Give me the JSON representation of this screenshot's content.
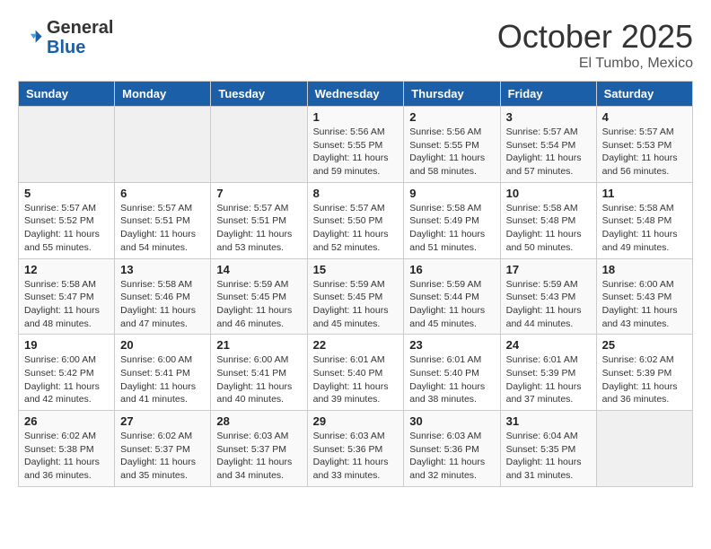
{
  "header": {
    "logo_general": "General",
    "logo_blue": "Blue",
    "month_title": "October 2025",
    "location": "El Tumbo, Mexico"
  },
  "days_of_week": [
    "Sunday",
    "Monday",
    "Tuesday",
    "Wednesday",
    "Thursday",
    "Friday",
    "Saturday"
  ],
  "weeks": [
    [
      {
        "day": "",
        "info": ""
      },
      {
        "day": "",
        "info": ""
      },
      {
        "day": "",
        "info": ""
      },
      {
        "day": "1",
        "info": "Sunrise: 5:56 AM\nSunset: 5:55 PM\nDaylight: 11 hours and 59 minutes."
      },
      {
        "day": "2",
        "info": "Sunrise: 5:56 AM\nSunset: 5:55 PM\nDaylight: 11 hours and 58 minutes."
      },
      {
        "day": "3",
        "info": "Sunrise: 5:57 AM\nSunset: 5:54 PM\nDaylight: 11 hours and 57 minutes."
      },
      {
        "day": "4",
        "info": "Sunrise: 5:57 AM\nSunset: 5:53 PM\nDaylight: 11 hours and 56 minutes."
      }
    ],
    [
      {
        "day": "5",
        "info": "Sunrise: 5:57 AM\nSunset: 5:52 PM\nDaylight: 11 hours and 55 minutes."
      },
      {
        "day": "6",
        "info": "Sunrise: 5:57 AM\nSunset: 5:51 PM\nDaylight: 11 hours and 54 minutes."
      },
      {
        "day": "7",
        "info": "Sunrise: 5:57 AM\nSunset: 5:51 PM\nDaylight: 11 hours and 53 minutes."
      },
      {
        "day": "8",
        "info": "Sunrise: 5:57 AM\nSunset: 5:50 PM\nDaylight: 11 hours and 52 minutes."
      },
      {
        "day": "9",
        "info": "Sunrise: 5:58 AM\nSunset: 5:49 PM\nDaylight: 11 hours and 51 minutes."
      },
      {
        "day": "10",
        "info": "Sunrise: 5:58 AM\nSunset: 5:48 PM\nDaylight: 11 hours and 50 minutes."
      },
      {
        "day": "11",
        "info": "Sunrise: 5:58 AM\nSunset: 5:48 PM\nDaylight: 11 hours and 49 minutes."
      }
    ],
    [
      {
        "day": "12",
        "info": "Sunrise: 5:58 AM\nSunset: 5:47 PM\nDaylight: 11 hours and 48 minutes."
      },
      {
        "day": "13",
        "info": "Sunrise: 5:58 AM\nSunset: 5:46 PM\nDaylight: 11 hours and 47 minutes."
      },
      {
        "day": "14",
        "info": "Sunrise: 5:59 AM\nSunset: 5:45 PM\nDaylight: 11 hours and 46 minutes."
      },
      {
        "day": "15",
        "info": "Sunrise: 5:59 AM\nSunset: 5:45 PM\nDaylight: 11 hours and 45 minutes."
      },
      {
        "day": "16",
        "info": "Sunrise: 5:59 AM\nSunset: 5:44 PM\nDaylight: 11 hours and 45 minutes."
      },
      {
        "day": "17",
        "info": "Sunrise: 5:59 AM\nSunset: 5:43 PM\nDaylight: 11 hours and 44 minutes."
      },
      {
        "day": "18",
        "info": "Sunrise: 6:00 AM\nSunset: 5:43 PM\nDaylight: 11 hours and 43 minutes."
      }
    ],
    [
      {
        "day": "19",
        "info": "Sunrise: 6:00 AM\nSunset: 5:42 PM\nDaylight: 11 hours and 42 minutes."
      },
      {
        "day": "20",
        "info": "Sunrise: 6:00 AM\nSunset: 5:41 PM\nDaylight: 11 hours and 41 minutes."
      },
      {
        "day": "21",
        "info": "Sunrise: 6:00 AM\nSunset: 5:41 PM\nDaylight: 11 hours and 40 minutes."
      },
      {
        "day": "22",
        "info": "Sunrise: 6:01 AM\nSunset: 5:40 PM\nDaylight: 11 hours and 39 minutes."
      },
      {
        "day": "23",
        "info": "Sunrise: 6:01 AM\nSunset: 5:40 PM\nDaylight: 11 hours and 38 minutes."
      },
      {
        "day": "24",
        "info": "Sunrise: 6:01 AM\nSunset: 5:39 PM\nDaylight: 11 hours and 37 minutes."
      },
      {
        "day": "25",
        "info": "Sunrise: 6:02 AM\nSunset: 5:39 PM\nDaylight: 11 hours and 36 minutes."
      }
    ],
    [
      {
        "day": "26",
        "info": "Sunrise: 6:02 AM\nSunset: 5:38 PM\nDaylight: 11 hours and 36 minutes."
      },
      {
        "day": "27",
        "info": "Sunrise: 6:02 AM\nSunset: 5:37 PM\nDaylight: 11 hours and 35 minutes."
      },
      {
        "day": "28",
        "info": "Sunrise: 6:03 AM\nSunset: 5:37 PM\nDaylight: 11 hours and 34 minutes."
      },
      {
        "day": "29",
        "info": "Sunrise: 6:03 AM\nSunset: 5:36 PM\nDaylight: 11 hours and 33 minutes."
      },
      {
        "day": "30",
        "info": "Sunrise: 6:03 AM\nSunset: 5:36 PM\nDaylight: 11 hours and 32 minutes."
      },
      {
        "day": "31",
        "info": "Sunrise: 6:04 AM\nSunset: 5:35 PM\nDaylight: 11 hours and 31 minutes."
      },
      {
        "day": "",
        "info": ""
      }
    ]
  ]
}
